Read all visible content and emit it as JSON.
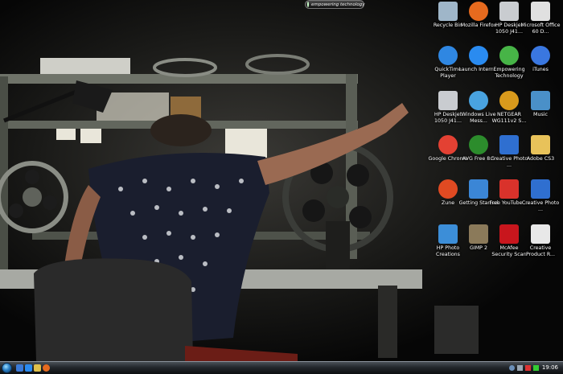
{
  "gadget": {
    "label": "empowering technology"
  },
  "desktop_icons": [
    {
      "id": "recycle-bin",
      "label": "Recycle Bin",
      "icon": "recycle-bin-icon",
      "color": "#9fb6c9"
    },
    {
      "id": "mozilla-firefox",
      "label": "Mozilla Firefox",
      "icon": "firefox-icon",
      "color": "#e66a1e"
    },
    {
      "id": "hp-deskjet-1050-a",
      "label": "HP Deskjet 1050 J41...",
      "icon": "printer-icon",
      "color": "#c9ccd0"
    },
    {
      "id": "microsoft-office-60-day",
      "label": "Microsoft Office 60 D...",
      "icon": "office-icon",
      "color": "#e0e0e0"
    },
    {
      "id": "quicktime-player",
      "label": "QuickTime Player",
      "icon": "quicktime-icon",
      "color": "#2f87e2"
    },
    {
      "id": "launch-internet",
      "label": "Launch Intern...",
      "icon": "internet-explorer-icon",
      "color": "#2a8bf0"
    },
    {
      "id": "empowering-technology",
      "label": "Empowering Technology",
      "icon": "empowering-technology-icon",
      "color": "#47b447"
    },
    {
      "id": "itunes",
      "label": "iTunes",
      "icon": "itunes-icon",
      "color": "#3a77e0"
    },
    {
      "id": "hp-deskjet-1050-b",
      "label": "HP Deskjet 1050 J41...",
      "icon": "printer-icon",
      "color": "#c9ccd0"
    },
    {
      "id": "windows-live-messenger",
      "label": "Windows Live Mess...",
      "icon": "messenger-icon",
      "color": "#49a3e0"
    },
    {
      "id": "netgear",
      "label": "NETGEAR WG111v2 S...",
      "icon": "netgear-icon",
      "color": "#d99a1c"
    },
    {
      "id": "music",
      "label": "Music",
      "icon": "music-folder-icon",
      "color": "#4a90c8"
    },
    {
      "id": "google-chrome",
      "label": "Google Chrome",
      "icon": "chrome-icon",
      "color": "#e34133"
    },
    {
      "id": "avg-free",
      "label": "AVG Free 8.5",
      "icon": "avg-icon",
      "color": "#2c8c2c"
    },
    {
      "id": "creative-photo-a",
      "label": "Creative Photo ...",
      "icon": "creative-photo-icon",
      "color": "#2f6fd0"
    },
    {
      "id": "adobe-cs3",
      "label": "Adobe CS3",
      "icon": "folder-icon",
      "color": "#e8c25a"
    },
    {
      "id": "zune",
      "label": "Zune",
      "icon": "zune-icon",
      "color": "#e04a22"
    },
    {
      "id": "getting-started",
      "label": "Getting Started",
      "icon": "getting-started-icon",
      "color": "#3b86d6"
    },
    {
      "id": "free-youtube",
      "label": "Free YouTube ...",
      "icon": "youtube-downloader-icon",
      "color": "#d9322b"
    },
    {
      "id": "creative-photo-b",
      "label": "Creative Photo ...",
      "icon": "creative-photo-icon",
      "color": "#2f6fd0"
    },
    {
      "id": "hp-photo-creations",
      "label": "HP Photo Creations",
      "icon": "hp-photo-icon",
      "color": "#3c8ed8"
    },
    {
      "id": "gimp-2",
      "label": "GIMP 2",
      "icon": "gimp-icon",
      "color": "#8b7a5a"
    },
    {
      "id": "mcafee",
      "label": "McAfee Security Scan",
      "icon": "mcafee-icon",
      "color": "#c8161d"
    },
    {
      "id": "creative-product-r",
      "label": "Creative Product R...",
      "icon": "creative-product-icon",
      "color": "#e8e8e8"
    }
  ],
  "taskbar": {
    "clock": "19:06"
  }
}
